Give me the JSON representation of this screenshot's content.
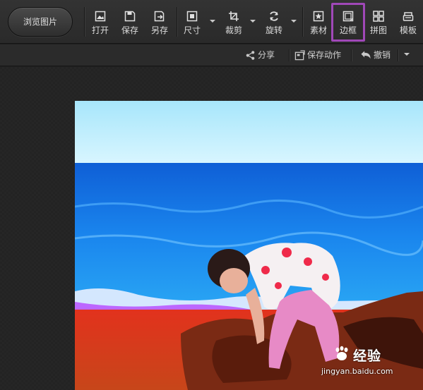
{
  "toolbar": {
    "browse_label": "浏览图片",
    "tools": [
      {
        "label": "打开",
        "icon": "open-image-icon"
      },
      {
        "label": "保存",
        "icon": "save-icon"
      },
      {
        "label": "另存",
        "icon": "save-as-icon"
      },
      {
        "label": "尺寸",
        "icon": "resize-icon"
      },
      {
        "label": "裁剪",
        "icon": "crop-icon"
      },
      {
        "label": "旋转",
        "icon": "rotate-icon"
      },
      {
        "label": "素材",
        "icon": "material-icon"
      },
      {
        "label": "边框",
        "icon": "frame-icon"
      },
      {
        "label": "拼图",
        "icon": "collage-icon"
      },
      {
        "label": "模板",
        "icon": "template-icon"
      }
    ],
    "highlight_color": "#a048b8"
  },
  "subbar": {
    "share_label": "分享",
    "save_action_label": "保存动作",
    "undo_label": "撤销"
  },
  "watermark": {
    "brand": "经验",
    "url": "jingyan.baidu.com"
  }
}
